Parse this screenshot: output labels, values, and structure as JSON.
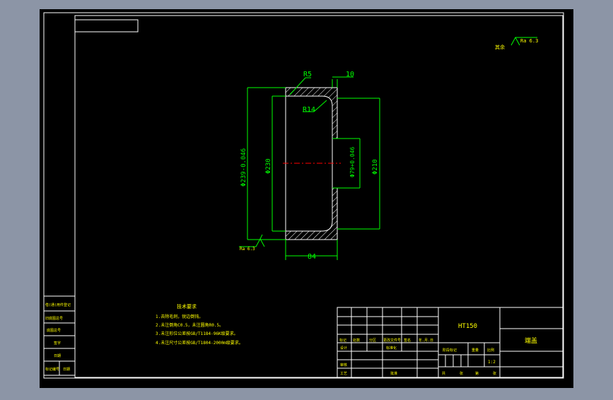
{
  "colors": {
    "background": "#8c95a6",
    "canvas": "#000000",
    "frame": "#ffffff",
    "dimension": "#00ff00",
    "annotation": "#ffff00",
    "centerline": "#ff0000",
    "hatch": "#ffffff"
  },
  "drawing": {
    "dim_r5": "R5",
    "dim_10": "10",
    "dim_r14": "R14",
    "dim_239": "Φ239-0.046",
    "dim_230": "Φ230",
    "dim_79": "Φ79+0.046",
    "dim_210": "Φ210",
    "dim_84": "84",
    "roughness_left": "Ra 6.3",
    "roughness_top_label": "其余",
    "roughness_top": "Ra 6.3"
  },
  "notes": {
    "title": "技术要求",
    "lines": [
      "1.去除毛刺，锐边倒钝。",
      "2.未注倒角C0.5，未注圆角R0.5。",
      "3.未注形位公差按GB/T1184-96K级要求。",
      "4.未注尺寸公差按GB/T1804-2000m级要求。"
    ]
  },
  "side_table": {
    "rows": [
      "借(通)用件登记",
      "旧底图总号",
      "底图总号",
      "签字",
      "日期"
    ],
    "bottom_left": "标记编号",
    "bottom_right": "日期"
  },
  "title_block": {
    "material": "HT150",
    "part_name": "端盖",
    "scale": "1:2",
    "header": [
      "标记",
      "处数",
      "分区",
      "更改文件号",
      "签名",
      "年.月.日"
    ],
    "labels": {
      "design": "设计",
      "standardize": "标准化",
      "stage_mark": "阶段标记",
      "weight": "重量",
      "scale_label": "比例",
      "review": "审核",
      "process": "工艺",
      "approve": "批准",
      "total": "共",
      "sheet": "张",
      "page": "第",
      "page_sheet": "张"
    }
  }
}
